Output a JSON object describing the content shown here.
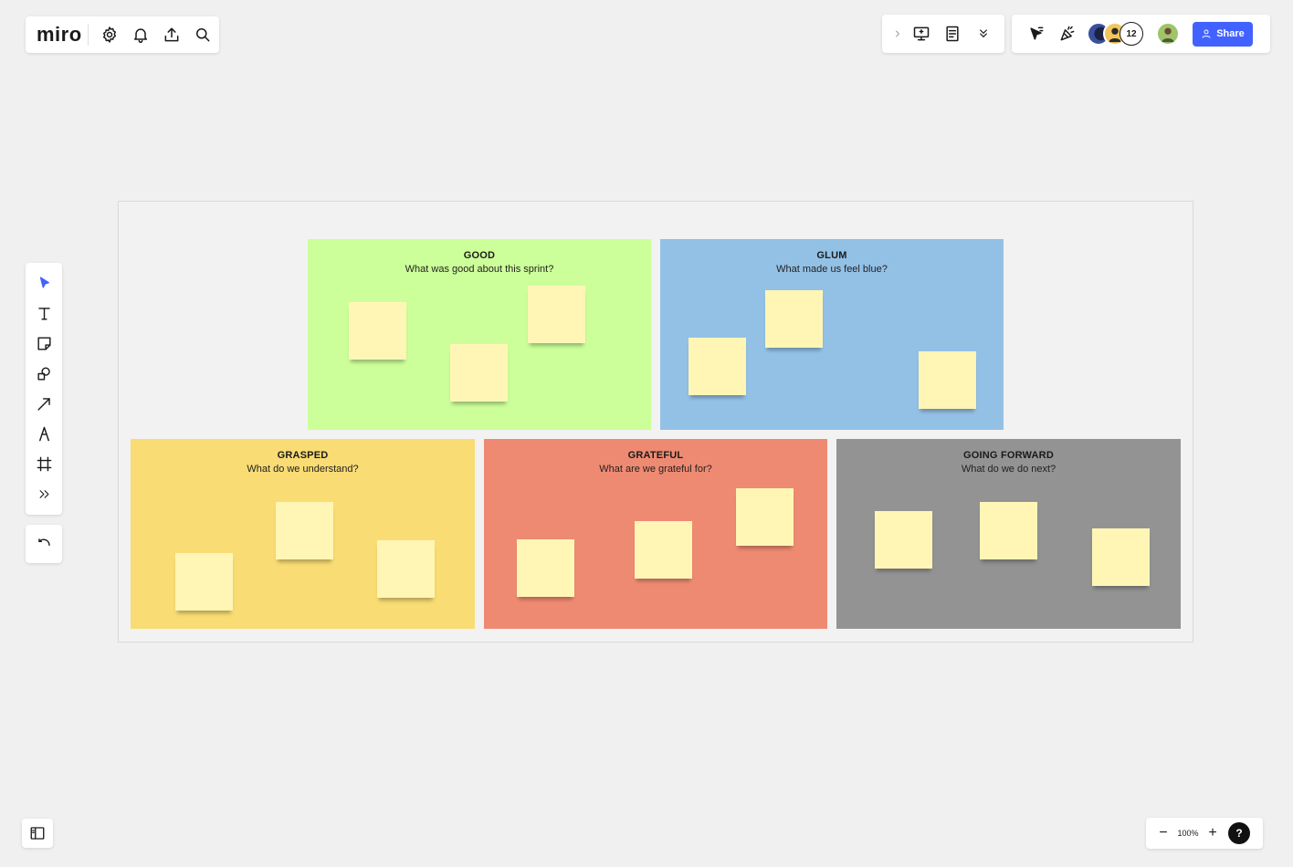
{
  "app": {
    "logo": "miro"
  },
  "top_left_icons": [
    "gear-icon",
    "bell-icon",
    "upload-icon",
    "search-icon"
  ],
  "top_mid_icons": [
    "chevron-right-icon",
    "present-icon",
    "notes-icon",
    "double-chevron-down-icon"
  ],
  "collaborators": {
    "count": "12"
  },
  "share": {
    "label": "Share"
  },
  "colors": {
    "accent": "#4262ff",
    "good": "#ccff99",
    "glum": "#93c1e6",
    "grasped": "#f9dc73",
    "grateful": "#ef8a72",
    "going_forward": "#939393",
    "sticky": "#fff6b6"
  },
  "frames": [
    {
      "title": "GOOD",
      "subtitle": "What was good about this sprint?",
      "stickies": 3
    },
    {
      "title": "GLUM",
      "subtitle": "What made us feel blue?",
      "stickies": 3
    },
    {
      "title": "GRASPED",
      "subtitle": "What do we understand?",
      "stickies": 3
    },
    {
      "title": "GRATEFUL",
      "subtitle": "What are we grateful for?",
      "stickies": 3
    },
    {
      "title": "GOING FORWARD",
      "subtitle": "What do we do next?",
      "stickies": 3
    }
  ],
  "zoom": {
    "label": "100%",
    "minus": "−",
    "plus": "+"
  },
  "help": {
    "label": "?"
  }
}
